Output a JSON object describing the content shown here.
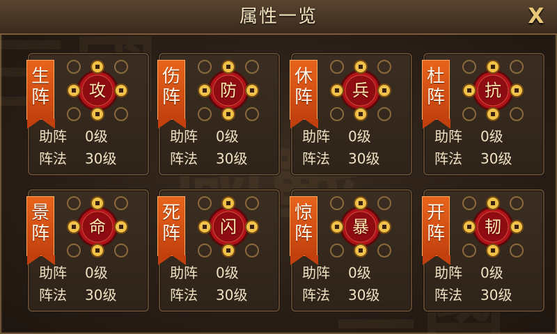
{
  "window": {
    "title": "属性一览",
    "close_label": "X"
  },
  "row_labels": {
    "assist": "助阵",
    "formation": "阵法"
  },
  "cards": [
    {
      "tag": "生阵",
      "emblem_char": "攻",
      "assist_value": "0级",
      "formation_value": "30级"
    },
    {
      "tag": "伤阵",
      "emblem_char": "防",
      "assist_value": "0级",
      "formation_value": "30级"
    },
    {
      "tag": "休阵",
      "emblem_char": "兵",
      "assist_value": "0级",
      "formation_value": "30级"
    },
    {
      "tag": "杜阵",
      "emblem_char": "抗",
      "assist_value": "0级",
      "formation_value": "30级"
    },
    {
      "tag": "景阵",
      "emblem_char": "命",
      "assist_value": "0级",
      "formation_value": "30级"
    },
    {
      "tag": "死阵",
      "emblem_char": "闪",
      "assist_value": "0级",
      "formation_value": "30级"
    },
    {
      "tag": "惊阵",
      "emblem_char": "暴",
      "assist_value": "0级",
      "formation_value": "30级"
    },
    {
      "tag": "开阵",
      "emblem_char": "韧",
      "assist_value": "0级",
      "formation_value": "30级"
    }
  ],
  "colors": {
    "tag": "#d9531a",
    "emblem": "#b0121a",
    "coin": "#f0c24a",
    "text": "#f1e2c4"
  }
}
